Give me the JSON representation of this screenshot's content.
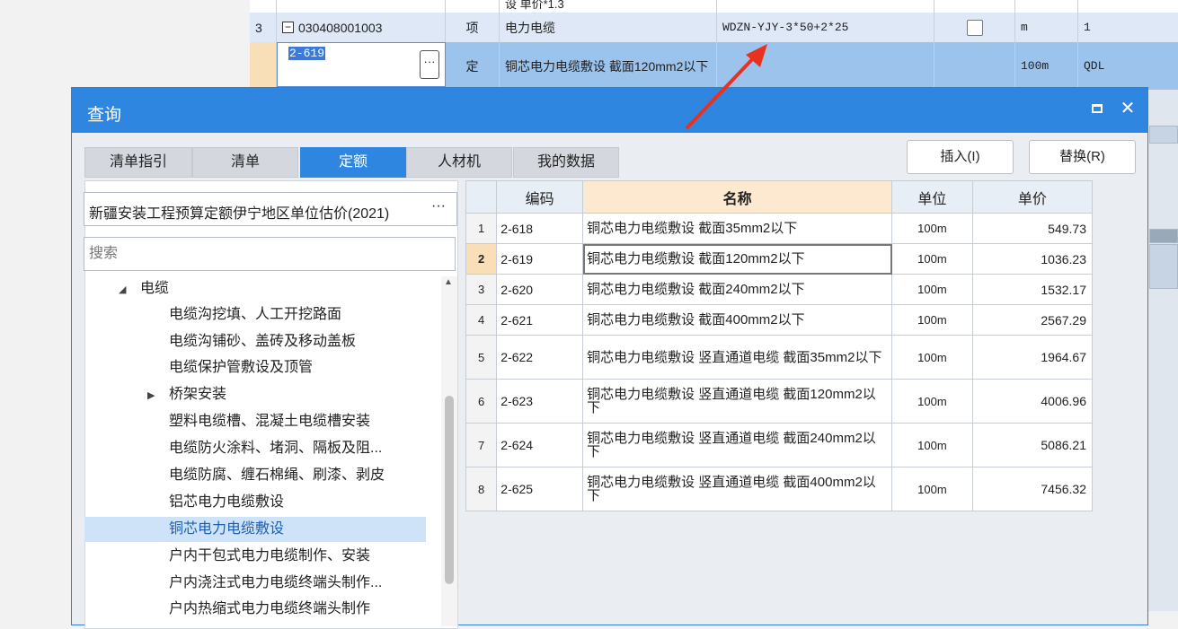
{
  "bill_grid": {
    "partial_row_text": "设 单价*1.3",
    "rows": [
      {
        "index": "3",
        "code": "030408001003",
        "type": "项",
        "name": "电力电缆",
        "spec": "WDZN-YJY-3*50+2*25",
        "unit": "m",
        "qty": "1"
      },
      {
        "index": "",
        "code": "2-619",
        "type": "定",
        "name": "铜芯电力电缆敷设 截面120mm2以下",
        "spec": "",
        "unit": "100m",
        "qty": "QDL"
      }
    ],
    "collapse_glyph": "−",
    "more_glyph": "···"
  },
  "dialog": {
    "title": "查询",
    "tabs": [
      "清单指引",
      "清单",
      "定额",
      "人材机",
      "我的数据"
    ],
    "active_tab": "定额",
    "insert_button": "插入(I)",
    "replace_button": "替换(R)",
    "library": "新疆安装工程预算定额伊宁地区单位估价(2021)",
    "library_more": "···",
    "search_placeholder": "搜索",
    "tree": [
      {
        "label": "电缆",
        "level": 1,
        "expanded": true
      },
      {
        "label": "电缆沟挖填、人工开挖路面",
        "level": 2
      },
      {
        "label": "电缆沟铺砂、盖砖及移动盖板",
        "level": 2
      },
      {
        "label": "电缆保护管敷设及顶管",
        "level": 2
      },
      {
        "label": "桥架安装",
        "level": 2,
        "collapsed": true
      },
      {
        "label": "塑料电缆槽、混凝土电缆槽安装",
        "level": 2
      },
      {
        "label": "电缆防火涂料、堵洞、隔板及阻...",
        "level": 2
      },
      {
        "label": "电缆防腐、缠石棉绳、刷漆、剥皮",
        "level": 2
      },
      {
        "label": "铝芯电力电缆敷设",
        "level": 2
      },
      {
        "label": "铜芯电力电缆敷设",
        "level": 2,
        "selected": true
      },
      {
        "label": "户内干包式电力电缆制作、安装",
        "level": 2
      },
      {
        "label": "户内浇注式电力电缆终端头制作...",
        "level": 2
      },
      {
        "label": "户内热缩式电力电缆终端头制作",
        "level": 2
      }
    ],
    "table": {
      "columns": [
        "编码",
        "名称",
        "单位",
        "单价"
      ],
      "rows": [
        {
          "no": "1",
          "code": "2-618",
          "name": "铜芯电力电缆敷设 截面35mm2以下",
          "unit": "100m",
          "price": "549.73"
        },
        {
          "no": "2",
          "code": "2-619",
          "name": "铜芯电力电缆敷设 截面120mm2以下",
          "unit": "100m",
          "price": "1036.23"
        },
        {
          "no": "3",
          "code": "2-620",
          "name": "铜芯电力电缆敷设 截面240mm2以下",
          "unit": "100m",
          "price": "1532.17"
        },
        {
          "no": "4",
          "code": "2-621",
          "name": "铜芯电力电缆敷设 截面400mm2以下",
          "unit": "100m",
          "price": "2567.29"
        },
        {
          "no": "5",
          "code": "2-622",
          "name": "铜芯电力电缆敷设 竖直通道电缆 截面35mm2以下",
          "unit": "100m",
          "price": "1964.67"
        },
        {
          "no": "6",
          "code": "2-623",
          "name": "铜芯电力电缆敷设 竖直通道电缆 截面120mm2以下",
          "unit": "100m",
          "price": "4006.96"
        },
        {
          "no": "7",
          "code": "2-624",
          "name": "铜芯电力电缆敷设 竖直通道电缆 截面240mm2以下",
          "unit": "100m",
          "price": "5086.21"
        },
        {
          "no": "8",
          "code": "2-625",
          "name": "铜芯电力电缆敷设 竖直通道电缆 截面400mm2以下",
          "unit": "100m",
          "price": "7456.32"
        }
      ],
      "selected_row": "2"
    }
  },
  "icons": {
    "close": "✕",
    "maximize": "maximize-icon",
    "expanded": "◢",
    "collapsed": "▶",
    "scroll_up": "▲"
  },
  "colors": {
    "title_bar": "#2f86e0",
    "selected_row": "#9cc3ec",
    "tree_selected": "#cfe3f8",
    "arrow": "#e8321f"
  }
}
